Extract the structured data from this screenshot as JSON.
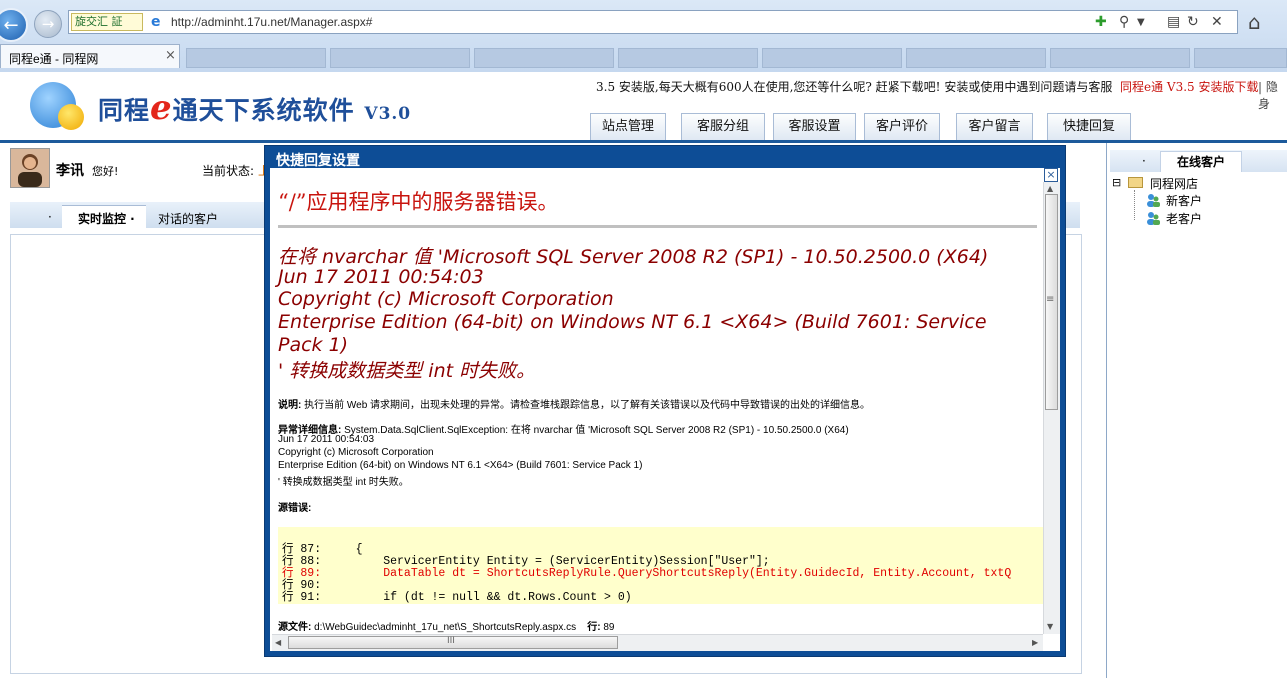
{
  "browser": {
    "extension_label": "旋交汇 証",
    "url": "http://adminht.17u.net/Manager.aspx#",
    "tab_title": "同程e通 - 同程网",
    "tab_close": "×"
  },
  "header": {
    "logo_pre": "同程",
    "logo_e": "e",
    "logo_post": "通天下系统软件 ",
    "logo_version": "V3.0",
    "notice": "3.5 安装版,每天大概有600人在使用,您还等什么呢? 赶紧下载吧! 安装或使用中遇到问题请与客服",
    "download_link": "同程e通 V3.5 安装版下载",
    "hide_link": "| 隐身"
  },
  "nav": {
    "tabs": [
      {
        "label": "站点管理"
      },
      {
        "label": "客服分组"
      },
      {
        "label": "客服设置"
      },
      {
        "label": "客户评价"
      },
      {
        "label": "客户留言"
      },
      {
        "label": "快捷回复"
      }
    ]
  },
  "user": {
    "name": "李讯",
    "greeting": "您好!",
    "status_label": "当前状态:",
    "status_value": "上"
  },
  "subtabs": {
    "dot": "·",
    "active": "实时监控 ·",
    "other": "对话的客户"
  },
  "right_panel": {
    "tab_dot": "·",
    "tab_label": "在线客户",
    "tree": {
      "toggle": "⊟",
      "root": "同程网店",
      "children": [
        "新客户",
        "老客户"
      ]
    }
  },
  "dialog": {
    "title": "快捷回复设置",
    "close": "×",
    "error_title": "“/”应用程序中的服务器错误。",
    "error_lines": [
      "在将 nvarchar 值 'Microsoft SQL Server 2008 R2 (SP1) - 10.50.2500.0 (X64)",
      "Jun 17 2011 00:54:03",
      "Copyright (c) Microsoft Corporation",
      "Enterprise Edition (64-bit) on Windows NT 6.1 <X64> (Build 7601: Service",
      "Pack 1)",
      "' 转换成数据类型 int 时失败。"
    ],
    "description_label": "说明:",
    "description_text": " 执行当前 Web 请求期间，出现未处理的异常。请检查堆栈跟踪信息，以了解有关该错误以及代码中导致错误的出处的详细信息。",
    "exception_label": "异常详细信息:",
    "exception_text": " System.Data.SqlClient.SqlException: 在将 nvarchar 值 'Microsoft SQL Server 2008 R2 (SP1) - 10.50.2500.0 (X64)",
    "exception_lines": [
      "Jun 17 2011 00:54:03",
      "Copyright (c) Microsoft Corporation",
      "Enterprise Edition (64-bit) on Windows NT 6.1 <X64> (Build 7601: Service Pack 1)",
      "' 转换成数据类型 int 时失败。"
    ],
    "source_error_label": "源错误:",
    "code_lines": [
      "行 87:     {",
      "行 88:         ServicerEntity Entity = (ServicerEntity)Session[\"User\"];",
      "行 89:         DataTable dt = ShortcutsReplyRule.QueryShortcutsReply(Entity.GuidecId, Entity.Account, txtQ",
      "行 90:",
      "行 91:         if (dt != null && dt.Rows.Count > 0)"
    ],
    "source_file_label": "源文件:",
    "source_file_text": " d:\\WebGuidec\\adminht_17u_net\\S_ShortcutsReply.aspx.cs",
    "line_label": "行:",
    "line_value": " 89",
    "hscroll_grip": "III",
    "vscroll_grip": "≡"
  },
  "colors": {
    "accent_blue": "#0d4d96",
    "error_red": "#c8140e",
    "error_dark_red": "#8b0000",
    "code_highlight": "#ffffcc"
  },
  "icons": {
    "back": "arrow-left-icon",
    "forward": "arrow-right-icon",
    "ie": "ie-icon",
    "refresh": "refresh-icon",
    "stop": "stop-icon",
    "search": "search-icon",
    "home": "home-icon",
    "compat": "compat-view-icon",
    "folder": "folder-icon",
    "user": "user-icon"
  }
}
